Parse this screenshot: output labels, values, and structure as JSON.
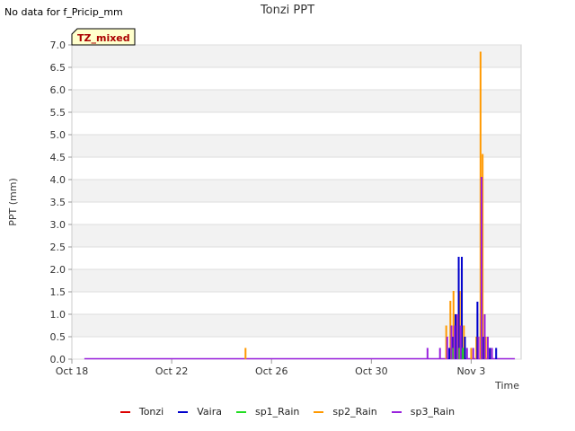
{
  "header": {
    "no_data_text": "No data for f_Pricip_mm",
    "title": "Tonzi PPT"
  },
  "chart_data": {
    "type": "bar",
    "title": "Tonzi PPT",
    "xlabel": "Time",
    "ylabel": "PPT (mm)",
    "ylim": [
      0,
      7.0
    ],
    "y_ticks": [
      "0.0",
      "0.5",
      "1.0",
      "1.5",
      "2.0",
      "2.5",
      "3.0",
      "3.5",
      "4.0",
      "4.5",
      "5.0",
      "5.5",
      "6.0",
      "6.5",
      "7.0"
    ],
    "x_ticks": [
      {
        "label": "Oct 18",
        "value": "2018-10-18"
      },
      {
        "label": "Oct 22",
        "value": "2018-10-22"
      },
      {
        "label": "Oct 26",
        "value": "2018-10-26"
      },
      {
        "label": "Oct 30",
        "value": "2018-10-30"
      },
      {
        "label": "Nov 3",
        "value": "2018-11-03"
      }
    ],
    "x_range": [
      "2018-10-18T00:00",
      "2018-11-05T00:00"
    ],
    "grid": true,
    "annotation_box": "TZ_mixed",
    "series": [
      {
        "name": "Tonzi",
        "color": "#dd0000",
        "points": []
      },
      {
        "name": "Vaira",
        "color": "#0000cc",
        "points": [
          [
            "2018-11-02T03:00",
            0.25
          ],
          [
            "2018-11-02T06:00",
            0.5
          ],
          [
            "2018-11-02T09:00",
            1.0
          ],
          [
            "2018-11-02T12:00",
            2.28
          ],
          [
            "2018-11-02T15:00",
            2.28
          ],
          [
            "2018-11-02T18:00",
            0.5
          ],
          [
            "2018-11-03T06:00",
            1.28
          ],
          [
            "2018-11-03T12:00",
            0.5
          ],
          [
            "2018-11-03T18:00",
            0.25
          ],
          [
            "2018-11-04T00:00",
            0.25
          ]
        ]
      },
      {
        "name": "sp1_Rain",
        "color": "#22dd22",
        "points": [
          [
            "2018-11-02T06:00",
            0.25
          ],
          [
            "2018-11-02T12:00",
            0.25
          ],
          [
            "2018-11-02T16:00",
            0.25
          ]
        ]
      },
      {
        "name": "sp2_Rain",
        "color": "#ff9900",
        "points": [
          [
            "2018-10-24T23:00",
            0.25
          ],
          [
            "2018-11-02T00:00",
            0.75
          ],
          [
            "2018-11-02T04:00",
            1.3
          ],
          [
            "2018-11-02T07:00",
            1.52
          ],
          [
            "2018-11-02T10:00",
            1.0
          ],
          [
            "2018-11-02T13:00",
            1.52
          ],
          [
            "2018-11-02T17:00",
            0.75
          ],
          [
            "2018-11-03T00:00",
            0.25
          ],
          [
            "2018-11-03T05:00",
            0.5
          ],
          [
            "2018-11-03T09:00",
            6.85
          ],
          [
            "2018-11-03T11:00",
            4.57
          ],
          [
            "2018-11-03T14:00",
            0.5
          ],
          [
            "2018-11-03T18:00",
            0.25
          ]
        ]
      },
      {
        "name": "sp3_Rain",
        "color": "#9922dd",
        "points": [
          [
            "2018-11-01T06:00",
            0.25
          ],
          [
            "2018-11-01T18:00",
            0.25
          ],
          [
            "2018-11-02T01:00",
            0.5
          ],
          [
            "2018-11-02T05:00",
            0.75
          ],
          [
            "2018-11-02T08:00",
            0.75
          ],
          [
            "2018-11-02T11:00",
            1.0
          ],
          [
            "2018-11-02T14:00",
            0.75
          ],
          [
            "2018-11-02T20:00",
            0.25
          ],
          [
            "2018-11-03T02:00",
            0.25
          ],
          [
            "2018-11-03T07:00",
            0.5
          ],
          [
            "2018-11-03T10:00",
            4.06
          ],
          [
            "2018-11-03T13:00",
            1.0
          ],
          [
            "2018-11-03T16:00",
            0.5
          ],
          [
            "2018-11-03T20:00",
            0.25
          ]
        ]
      }
    ]
  }
}
